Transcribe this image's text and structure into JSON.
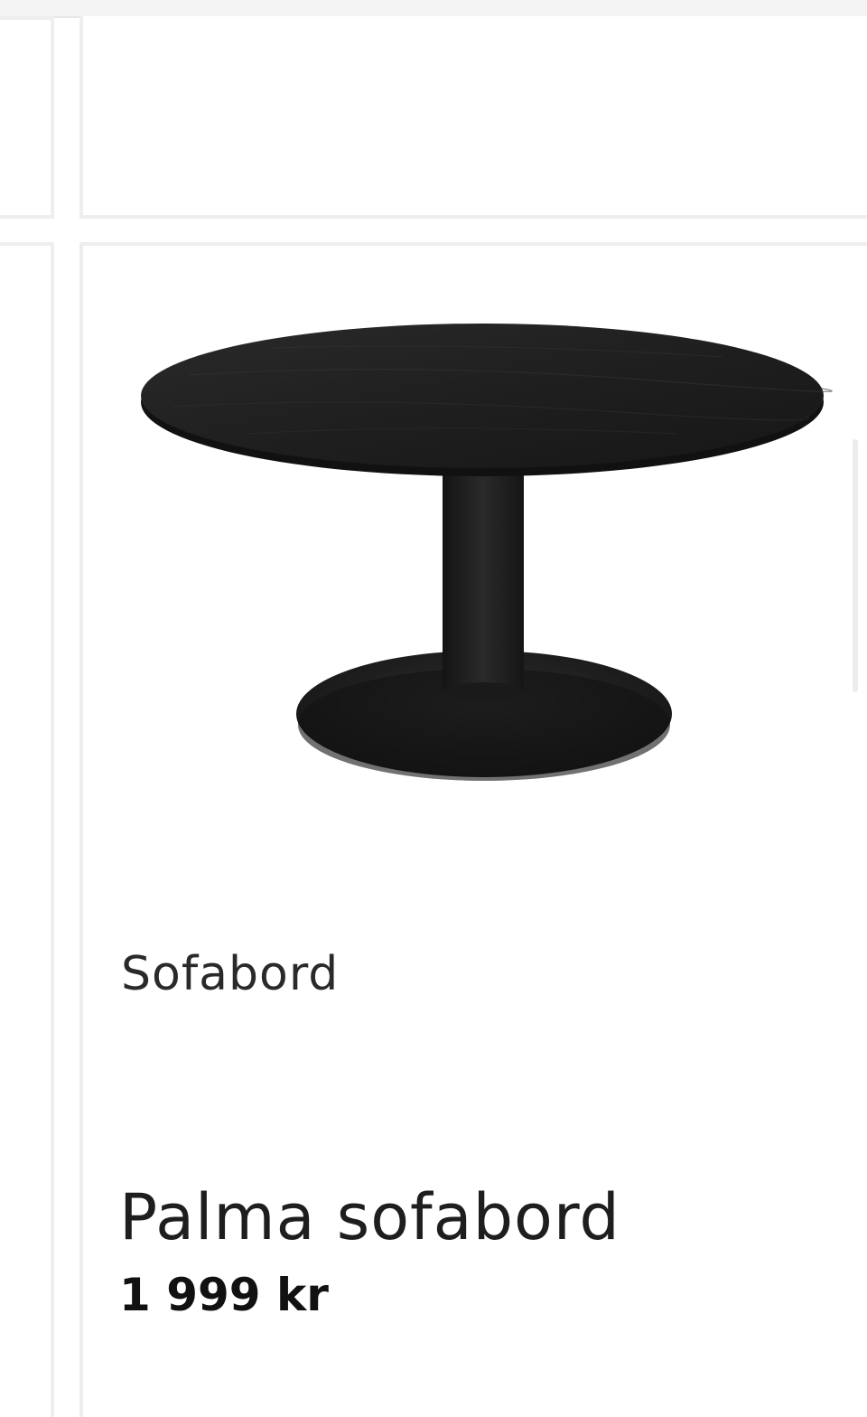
{
  "product": {
    "category": "Sofabord",
    "name": "Palma sofabord",
    "price": "1 999 kr",
    "image_icon": "round-pedestal-table-image"
  },
  "colors": {
    "table": "#1c1c1c",
    "card_border": "#eeeeee",
    "background": "#ffffff"
  }
}
